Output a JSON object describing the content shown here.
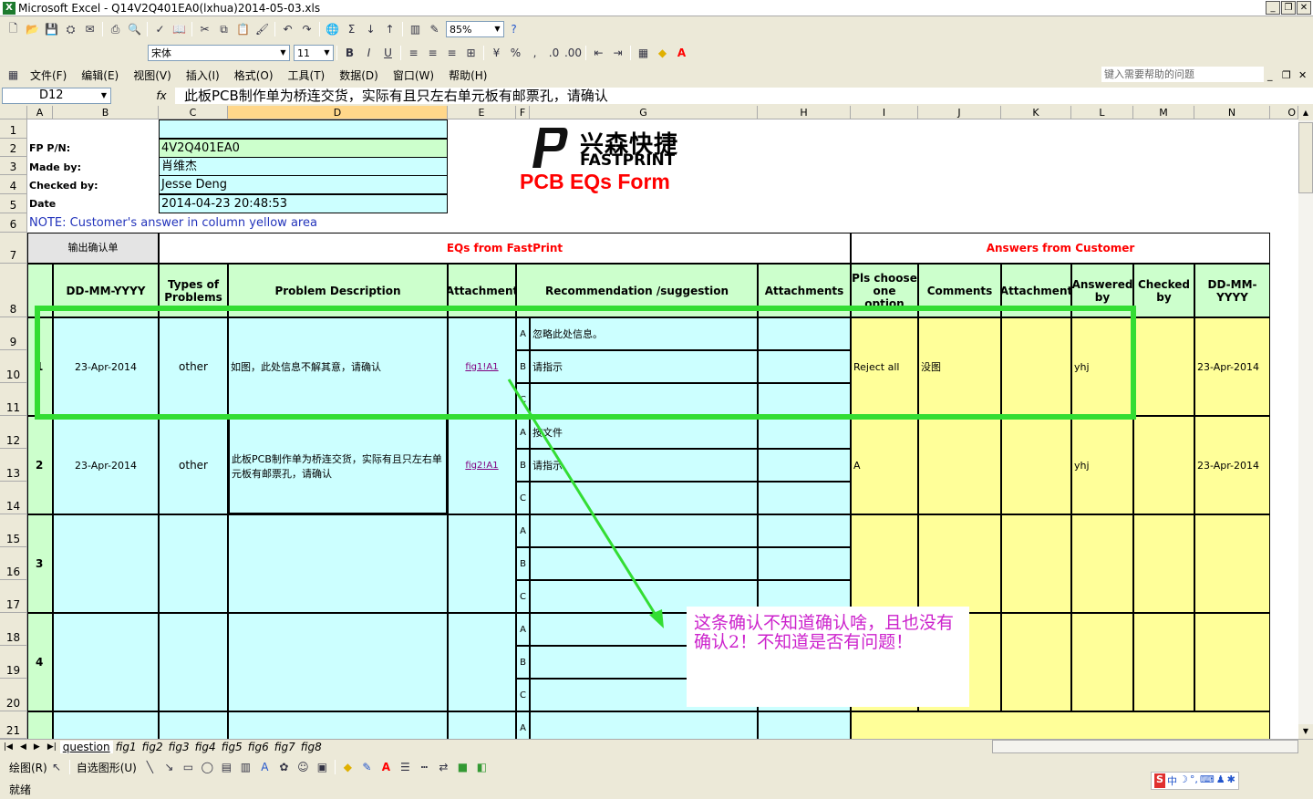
{
  "window": {
    "title": "Microsoft Excel - Q14V2Q401EA0(lxhua)2014-05-03.xls"
  },
  "toolbar": {
    "zoom": "85%",
    "font": "宋体",
    "size": "11"
  },
  "menu": [
    "文件(F)",
    "编辑(E)",
    "视图(V)",
    "插入(I)",
    "格式(O)",
    "工具(T)",
    "数据(D)",
    "窗口(W)",
    "帮助(H)"
  ],
  "help_placeholder": "键入需要帮助的问题",
  "formula_bar": {
    "cell_ref": "D12",
    "fx": "fx",
    "content": "此板PCB制作单为桥连交货，实际有且只左右单元板有邮票孔，请确认"
  },
  "columns": [
    "A",
    "B",
    "C",
    "D",
    "E",
    "F",
    "G",
    "H",
    "I",
    "J",
    "K",
    "L",
    "M",
    "N",
    "O"
  ],
  "rows": [
    "1",
    "2",
    "3",
    "4",
    "5",
    "6",
    "7",
    "8",
    "9",
    "10",
    "11",
    "12",
    "13",
    "14",
    "15",
    "16",
    "17",
    "18",
    "19",
    "20",
    "21"
  ],
  "info": {
    "fp_label": "FP P/N:",
    "fp_value": "4V2Q401EA0",
    "made_label": "Made by:",
    "made_value": "肖维杰",
    "checked_label": "Checked by:",
    "checked_value": "Jesse Deng",
    "date_label": "Date",
    "date_value": "2014-04-23 20:48:53",
    "note": "NOTE: Customer's  answer in column yellow area"
  },
  "logo": {
    "cn": "兴森快捷",
    "en": "FASTPRINT",
    "form_title": "PCB EQs Form"
  },
  "export_button": "输出确认单",
  "section_eq": "EQs from FastPrint",
  "section_answers": "Answers from Customer",
  "headers": {
    "star": "*",
    "date": "DD-MM-YYYY",
    "types": "Types of Problems",
    "problem": "Problem Description",
    "attachment": "Attachment",
    "recommend": "Recommendation /suggestion",
    "attachments": "Attachments",
    "pls": "Pls choose one option",
    "comments": "Comments",
    "attachment2": "Attachment",
    "answered": "Answered by",
    "checkedby": "Checked by",
    "date2": "DD-MM-YYYY"
  },
  "options": [
    "A",
    "B",
    "C"
  ],
  "eqs": [
    {
      "num": "1",
      "date": "23-Apr-2014",
      "type": "other",
      "problem": "如图，此处信息不解其意，请确认",
      "attach": "fig1!A1",
      "recA": "忽略此处信息。",
      "recB": "请指示",
      "recC": "",
      "choice": "Reject all",
      "comment": "没图",
      "answered": "yhj",
      "date2": "23-Apr-2014"
    },
    {
      "num": "2",
      "date": "23-Apr-2014",
      "type": "other",
      "problem": "此板PCB制作单为桥连交货，实际有且只左右单元板有邮票孔，请确认",
      "attach": "fig2!A1",
      "recA": "按文件",
      "recB": "请指示",
      "recC": "",
      "choice": "A",
      "comment": "",
      "answered": "yhj",
      "date2": "23-Apr-2014"
    },
    {
      "num": "3",
      "date": "",
      "type": "",
      "problem": "",
      "attach": "",
      "recA": "",
      "recB": "",
      "recC": "",
      "choice": "",
      "comment": "",
      "answered": "",
      "date2": ""
    },
    {
      "num": "4",
      "date": "",
      "type": "",
      "problem": "",
      "attach": "",
      "recA": "",
      "recB": "",
      "recC": "",
      "choice": "",
      "comment": "",
      "answered": "",
      "date2": ""
    }
  ],
  "row21_option": "A",
  "annotation": "这条确认不知道确认啥，且也没有确认2！不知道是否有问题！",
  "sheet_tabs": [
    "question",
    "fig1",
    "fig2",
    "fig3",
    "fig4",
    "fig5",
    "fig6",
    "fig7",
    "fig8"
  ],
  "draw_toolbar": {
    "draw": "绘图(R)",
    "autoshapes": "自选图形(U)"
  },
  "status": "就绪",
  "colors": {
    "cyan": "#ccffff",
    "green": "#ccffcc",
    "yellow": "#ffff99",
    "red": "#ff0000",
    "highlight": "#33dd33",
    "annotation": "#cc22cc"
  }
}
